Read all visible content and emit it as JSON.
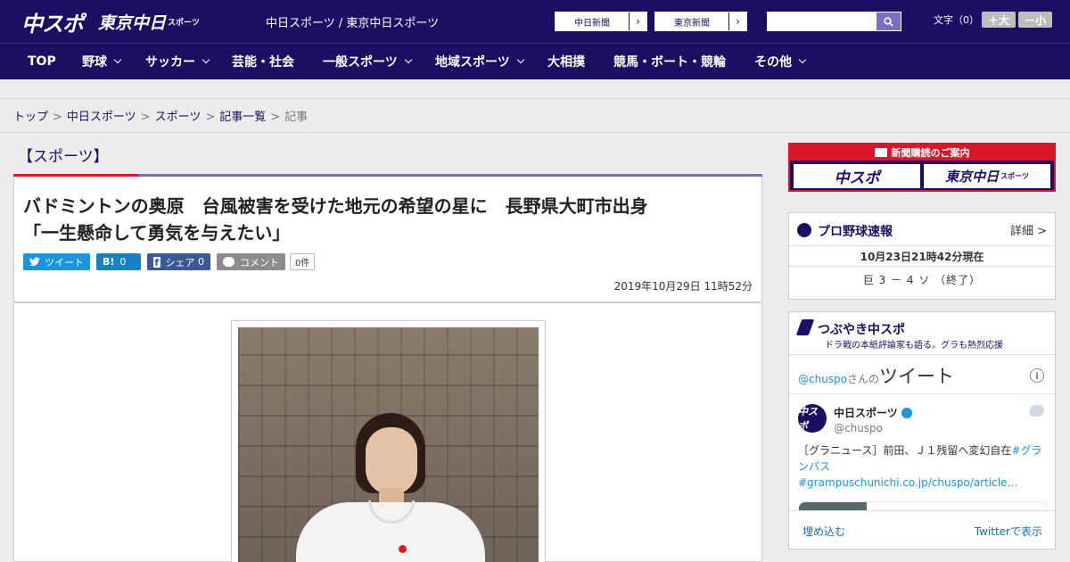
{
  "header": {
    "logo_chuspo": "中スポ",
    "logo_tokyo": "東京中日",
    "logo_tokyo_sub": "スポーツ",
    "site_label": "中日スポーツ / 東京中日スポーツ",
    "link_chunichi": "中日新聞",
    "link_tokyo": "東京新聞",
    "search_placeholder": "",
    "font_size_label": "文字（0）",
    "font_plus": "＋大",
    "font_minus": "－小"
  },
  "nav": {
    "items": [
      {
        "label": "TOP"
      },
      {
        "label": "野球"
      },
      {
        "label": "サッカー"
      },
      {
        "label": "芸能・社会"
      },
      {
        "label": "一般スポーツ"
      },
      {
        "label": "地域スポーツ"
      },
      {
        "label": "大相撲"
      },
      {
        "label": "競馬・ボート・競輪"
      },
      {
        "label": "その他"
      }
    ]
  },
  "breadcrumb": {
    "items": [
      "トップ",
      "中日スポーツ",
      "スポーツ",
      "記事一覧",
      "記事"
    ],
    "sep": ">"
  },
  "article": {
    "category": "【スポーツ】",
    "headline_line1": "バドミントンの奥原　台風被害を受けた地元の希望の星に　長野県大町市出身",
    "headline_line2": "「一生懸命して勇気を与えたい」",
    "share": {
      "twitter": "ツイート",
      "hatena_icon": "B!",
      "hatena_count": "0",
      "facebook": "シェア",
      "facebook_count": "0",
      "comment": "コメント",
      "comment_count": "0件"
    },
    "date": "2019年10月29日 11時52分"
  },
  "sidebar": {
    "ad": {
      "title": "新聞購読のご案内",
      "logo1": "中スポ",
      "logo2": "東京中日",
      "logo2_sub": "スポーツ"
    },
    "baseball": {
      "title": "プロ野球速報",
      "more": "詳細 >",
      "time": "10月23日21時42分現在",
      "score": "巨 3 － 4 ソ （終了）"
    },
    "tweets": {
      "title": "つぶやき中スポ",
      "subtitle": "ドラ戦の本紙評論家も語る。グラも熱烈応援",
      "header_user": "@chuspo",
      "header_suffix": "さんの",
      "header_big": "ツイート",
      "info": "i",
      "avatar_text": "中スポ",
      "name": "中日スポーツ",
      "handle": "@chuspo",
      "text_plain": "［グラニュース］前田、Ｊ１残留へ変幻自在",
      "text_tag1": "#グランパス",
      "text_link": "#grampuschunichi.co.jp/chuspo/article…",
      "embed": "埋め込む",
      "view": "Twitterで表示"
    }
  }
}
